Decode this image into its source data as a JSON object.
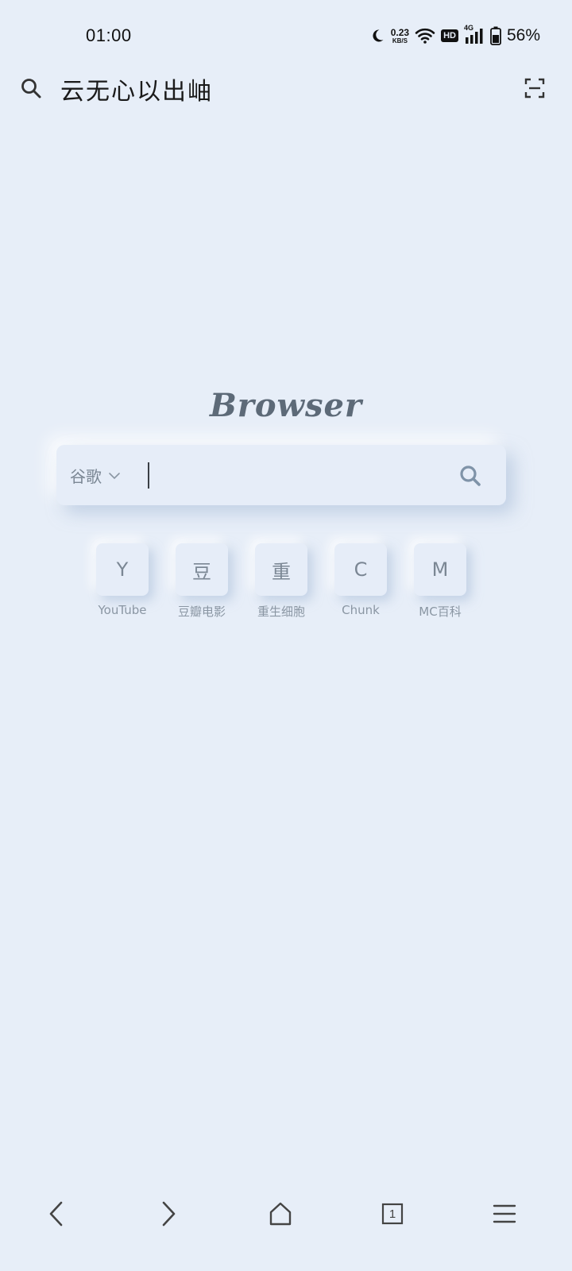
{
  "status_bar": {
    "time": "01:00",
    "net_speed_value": "0.23",
    "net_speed_unit": "KB/S",
    "hd_label": "HD",
    "network_type": "4G",
    "battery_percent": "56%"
  },
  "header": {
    "title": "云无心以出岫"
  },
  "brand": {
    "logo_text": "Browser"
  },
  "search": {
    "engine": "谷歌",
    "query": "",
    "placeholder": ""
  },
  "shortcuts": [
    {
      "initial": "Y",
      "label": "YouTube"
    },
    {
      "initial": "豆",
      "label": "豆瓣电影"
    },
    {
      "initial": "重",
      "label": "重生细胞"
    },
    {
      "initial": "C",
      "label": "Chunk"
    },
    {
      "initial": "M",
      "label": "MC百科"
    }
  ],
  "bottom_nav": {
    "tab_count": "1"
  },
  "colors": {
    "background": "#e7eef8",
    "muted_text": "#7b8794",
    "icon_dark": "#333333"
  },
  "icons": {
    "header_left": "search-icon",
    "header_right": "scan-icon",
    "search_button": "search-icon",
    "nav": [
      "back-icon",
      "forward-icon",
      "home-icon",
      "tabs-icon",
      "menu-icon"
    ]
  }
}
